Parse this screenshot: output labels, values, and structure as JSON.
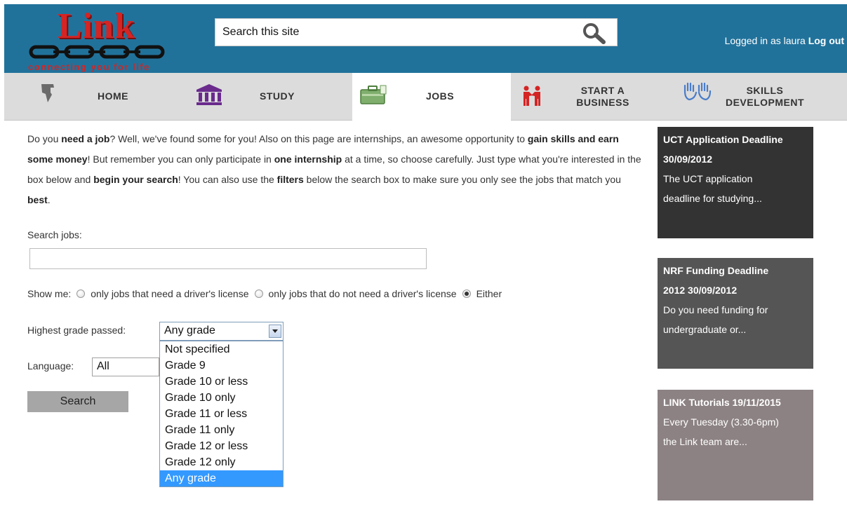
{
  "header": {
    "logo_word": "Link",
    "logo_tagline": "connecting you for life",
    "search_placeholder": "Search this site",
    "user_prefix": "Logged in as laura",
    "logout_label": "Log out"
  },
  "nav": {
    "items": [
      {
        "label": "HOME",
        "icon": "home-icon"
      },
      {
        "label": "STUDY",
        "icon": "study-building-icon"
      },
      {
        "label": "JOBS",
        "icon": "jobs-briefcase-icon",
        "active": true
      },
      {
        "label_line1": "START A",
        "label_line2": "BUSINESS",
        "icon": "handshake-icon"
      },
      {
        "label_line1": "SKILLS",
        "label_line2": "DEVELOPMENT",
        "icon": "hands-icon"
      }
    ]
  },
  "intro": {
    "p1": "Do you ",
    "b1": "need a job",
    "p2": "? Well, we've found some for you! Also on this page are internships, an awesome opportunity to ",
    "b2": "gain skills and earn some money",
    "p3": "! But remember you can only participate in ",
    "b3": "one internship",
    "p4": " at a time, so choose carefully. Just type what you're interested in the box below and ",
    "b4": "begin your search",
    "p5": "! You can also use the ",
    "b5": "filters",
    "p6": " below the search box to make sure you only see the jobs that match you ",
    "b6": "best",
    "p7": "."
  },
  "search_form": {
    "search_jobs_label": "Search jobs:",
    "show_me_label": "Show me:",
    "radio_options": [
      {
        "label": "only jobs that need a driver's license",
        "checked": false
      },
      {
        "label": "only jobs that do not need a driver's license",
        "checked": false
      },
      {
        "label": "Either",
        "checked": true
      }
    ],
    "grade_label": "Highest grade passed:",
    "grade_selected": "Any grade",
    "grade_options": [
      "Not specified",
      "Grade 9",
      "Grade 10 or less",
      "Grade 10 only",
      "Grade 11 or less",
      "Grade 11 only",
      "Grade 12 or less",
      "Grade 12 only",
      "Any grade"
    ],
    "language_label": "Language:",
    "language_selected": "All",
    "search_button": "Search"
  },
  "sidebar": {
    "cards": [
      {
        "title_line1": "UCT Application Deadline",
        "title_line2": "30/09/2012",
        "body_line1": "The UCT application",
        "body_line2": "deadline for studying...",
        "bg": "#333333"
      },
      {
        "title_line1": "NRF Funding Deadline",
        "title_line2": "2012 30/09/2012",
        "body_line1": "Do you need funding for",
        "body_line2": "undergraduate or...",
        "bg": "#555555"
      },
      {
        "title_line1": "LINK Tutorials 19/11/2015",
        "title_line2": "",
        "body_line1": "Every Tuesday (3.30-6pm)",
        "body_line2": "the Link team are...",
        "bg": "#8c8283"
      }
    ]
  },
  "colors": {
    "header_bg": "#21729b",
    "logo_red": "#d42424",
    "nav_bg": "#dcdcdc",
    "select_highlight": "#3399ff",
    "button_gray": "#a6a6a6"
  }
}
